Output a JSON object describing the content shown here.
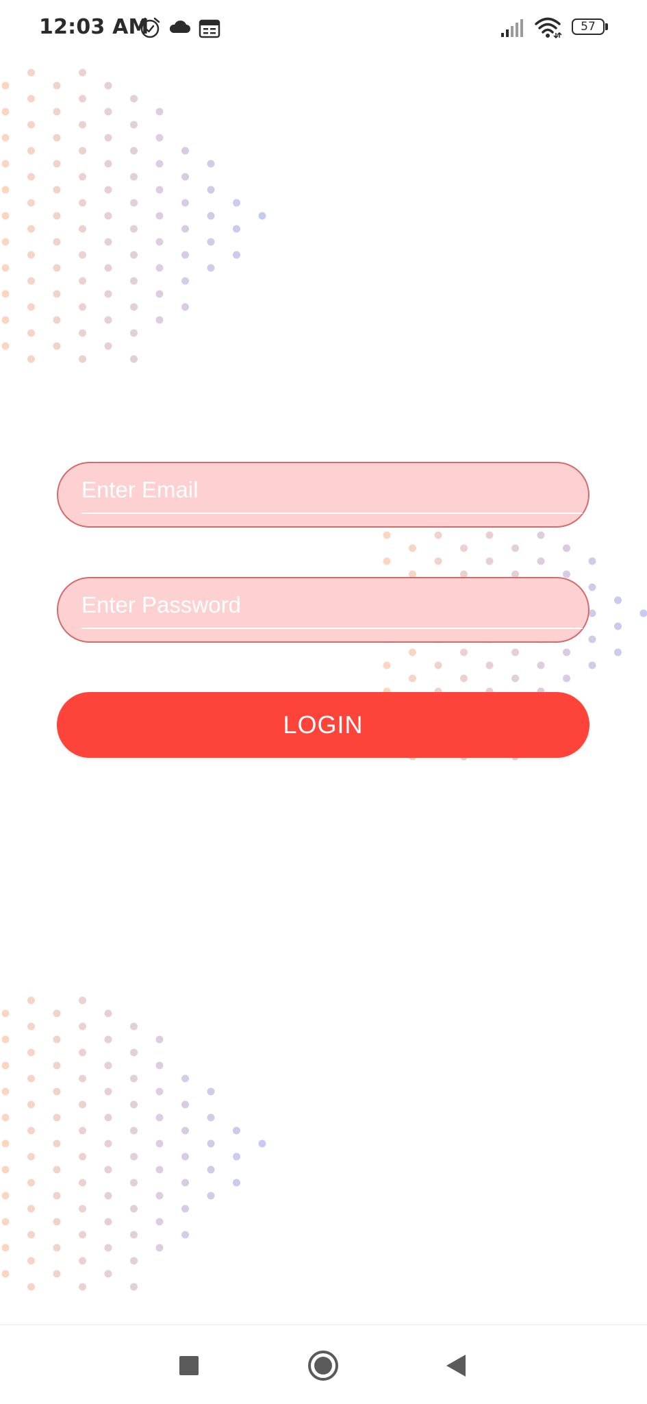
{
  "status_bar": {
    "time": "12:03 AM",
    "battery_level": "57",
    "icons": [
      "alarm-icon",
      "cloud-icon",
      "calendar-icon",
      "signal-icon",
      "wifi-icon",
      "battery-icon"
    ]
  },
  "form": {
    "email_placeholder": "Enter Email",
    "password_placeholder": "Enter Password",
    "login_label": "LOGIN"
  },
  "nav_bar": {
    "icons": [
      "recents-icon",
      "home-icon",
      "back-icon"
    ]
  },
  "colors": {
    "field_background": "#fdd1d1",
    "field_border": "#d66a6a",
    "button_background": "#fd443b",
    "dot_warm": "#f7b48e",
    "dot_cool": "#9a9ce8"
  }
}
